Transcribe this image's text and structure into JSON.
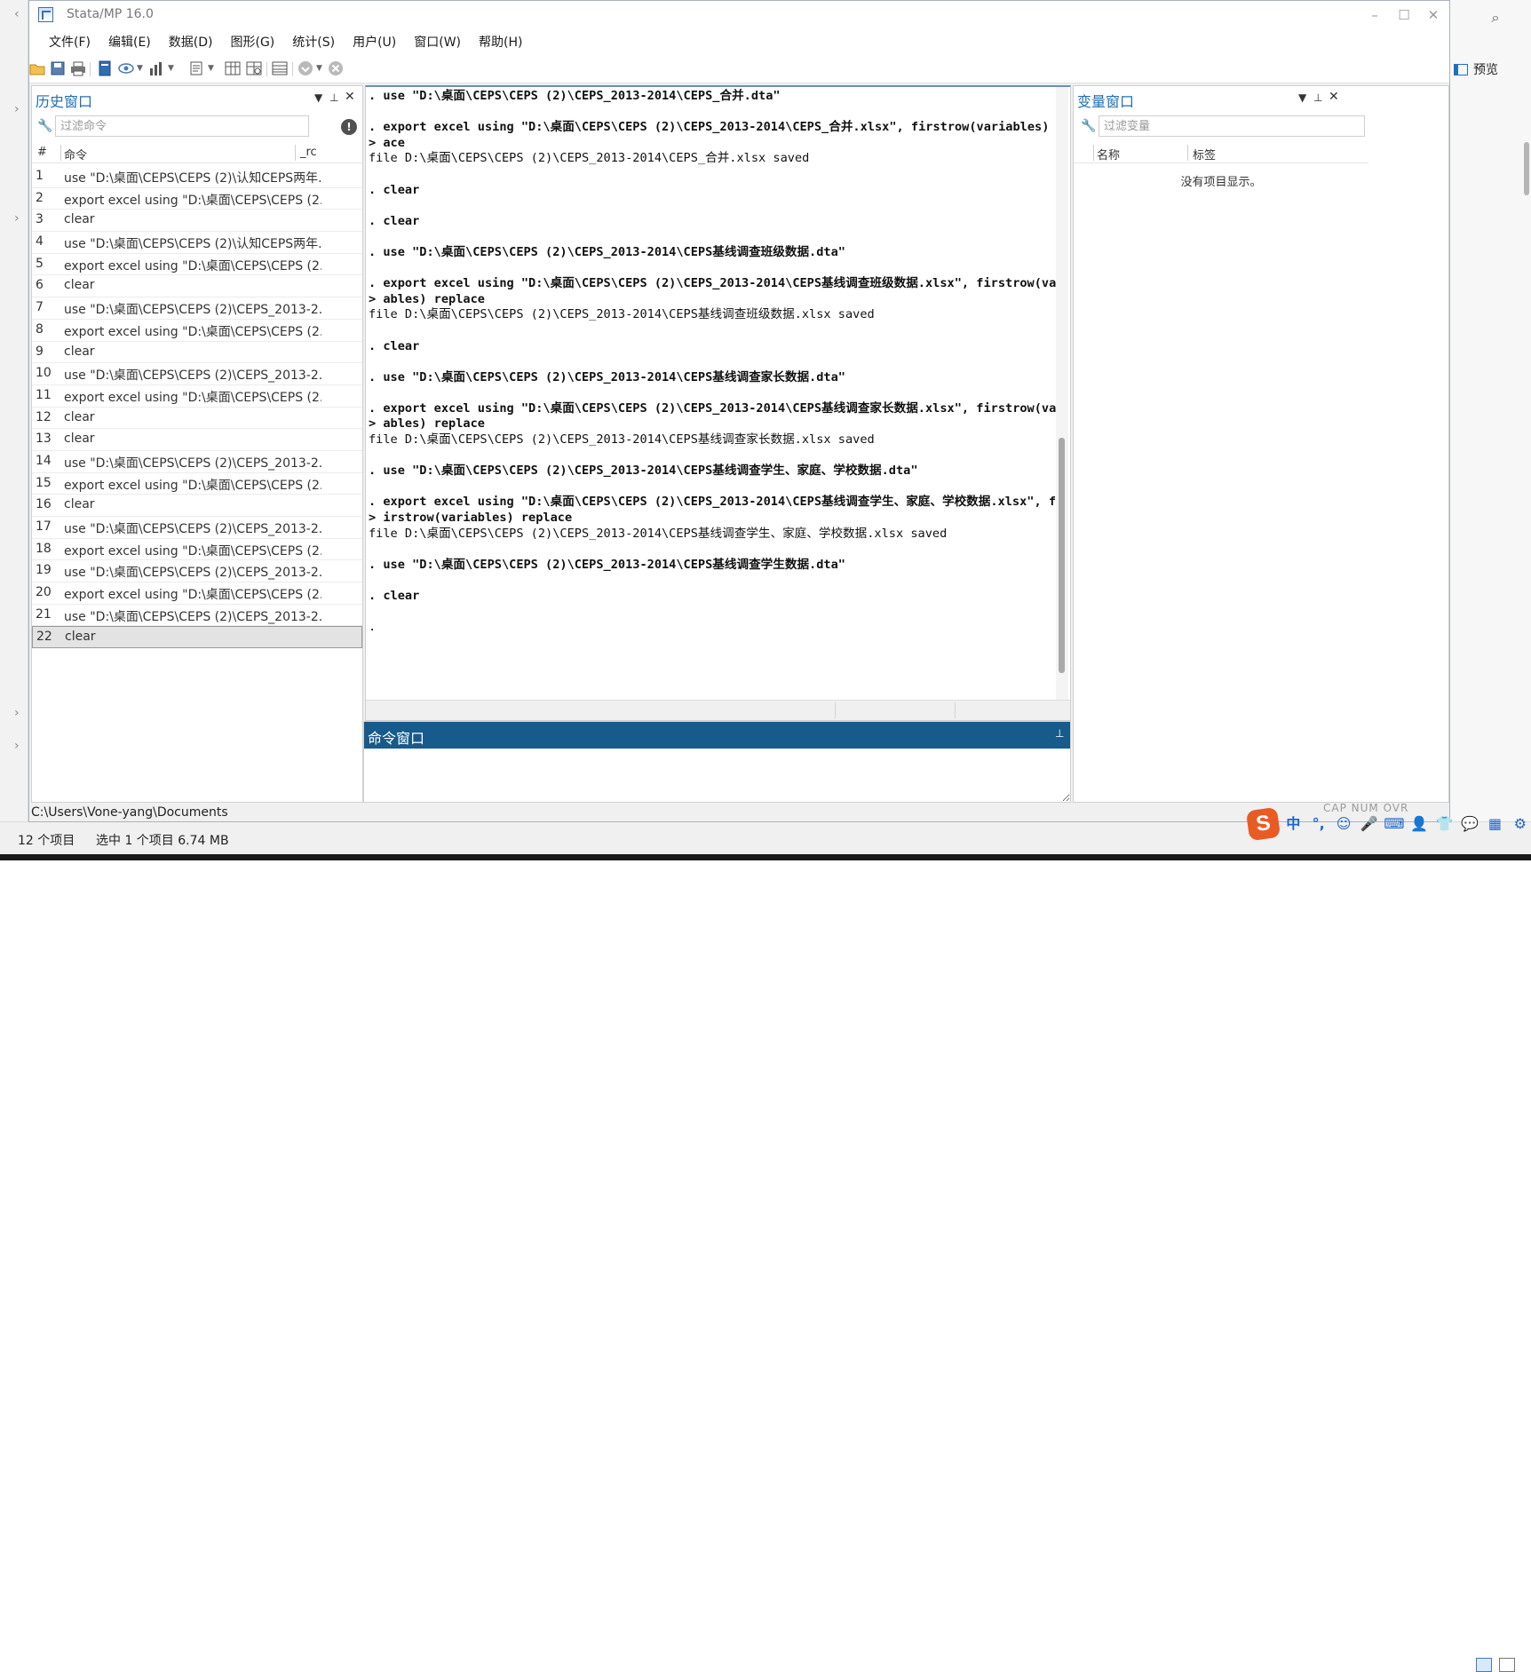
{
  "window": {
    "title": "Stata/MP 16.0",
    "controls": [
      "–",
      "☐",
      "✕"
    ]
  },
  "menu": [
    "文件(F)",
    "编辑(E)",
    "数据(D)",
    "图形(G)",
    "统计(S)",
    "用户(U)",
    "窗口(W)",
    "帮助(H)"
  ],
  "toolbar": {
    "icons": [
      "open-icon",
      "save-icon",
      "print-icon",
      "log-icon",
      "viewer-icon",
      "graph-icon",
      "do-file-editor-icon",
      "data-editor-icon",
      "data-browser-icon",
      "variables-manager-icon",
      "more-icon",
      "break-icon"
    ]
  },
  "history": {
    "title": "历史窗口",
    "filter_placeholder": "过滤命令",
    "columns": [
      "#",
      "命令",
      "_rc"
    ],
    "rows": [
      {
        "num": "1",
        "cmd": "use \"D:\\桌面\\CEPS\\CEPS (2)\\认知CEPS两年..."
      },
      {
        "num": "2",
        "cmd": "export excel using \"D:\\桌面\\CEPS\\CEPS (2..."
      },
      {
        "num": "3",
        "cmd": "clear"
      },
      {
        "num": "4",
        "cmd": "use \"D:\\桌面\\CEPS\\CEPS (2)\\认知CEPS两年..."
      },
      {
        "num": "5",
        "cmd": "export excel using \"D:\\桌面\\CEPS\\CEPS (2..."
      },
      {
        "num": "6",
        "cmd": "clear"
      },
      {
        "num": "7",
        "cmd": "use \"D:\\桌面\\CEPS\\CEPS (2)\\CEPS_2013-2..."
      },
      {
        "num": "8",
        "cmd": "export excel using \"D:\\桌面\\CEPS\\CEPS (2..."
      },
      {
        "num": "9",
        "cmd": "clear"
      },
      {
        "num": "10",
        "cmd": "use \"D:\\桌面\\CEPS\\CEPS (2)\\CEPS_2013-2..."
      },
      {
        "num": "11",
        "cmd": "export excel using \"D:\\桌面\\CEPS\\CEPS (2..."
      },
      {
        "num": "12",
        "cmd": "clear"
      },
      {
        "num": "13",
        "cmd": "clear"
      },
      {
        "num": "14",
        "cmd": "use \"D:\\桌面\\CEPS\\CEPS (2)\\CEPS_2013-2..."
      },
      {
        "num": "15",
        "cmd": "export excel using \"D:\\桌面\\CEPS\\CEPS (2..."
      },
      {
        "num": "16",
        "cmd": "clear"
      },
      {
        "num": "17",
        "cmd": "use \"D:\\桌面\\CEPS\\CEPS (2)\\CEPS_2013-2..."
      },
      {
        "num": "18",
        "cmd": "export excel using \"D:\\桌面\\CEPS\\CEPS (2..."
      },
      {
        "num": "19",
        "cmd": "use \"D:\\桌面\\CEPS\\CEPS (2)\\CEPS_2013-2..."
      },
      {
        "num": "20",
        "cmd": "export excel using \"D:\\桌面\\CEPS\\CEPS (2..."
      },
      {
        "num": "21",
        "cmd": "use \"D:\\桌面\\CEPS\\CEPS (2)\\CEPS_2013-2..."
      },
      {
        "num": "22",
        "cmd": "clear"
      }
    ],
    "selected_row": 22
  },
  "results": {
    "lines": [
      {
        "text": ". use \"D:\\桌面\\CEPS\\CEPS (2)\\CEPS_2013-2014\\CEPS_合并.dta\"",
        "bold": true
      },
      {
        "text": "",
        "bold": false
      },
      {
        "text": ". export excel using \"D:\\桌面\\CEPS\\CEPS (2)\\CEPS_2013-2014\\CEPS_合并.xlsx\", firstrow(variables) repl",
        "bold": true
      },
      {
        "text": "> ace",
        "bold": true
      },
      {
        "text": "file D:\\桌面\\CEPS\\CEPS (2)\\CEPS_2013-2014\\CEPS_合并.xlsx saved",
        "bold": false
      },
      {
        "text": "",
        "bold": false
      },
      {
        "text": ". clear",
        "bold": true
      },
      {
        "text": "",
        "bold": false
      },
      {
        "text": ". clear",
        "bold": true
      },
      {
        "text": "",
        "bold": false
      },
      {
        "text": ". use \"D:\\桌面\\CEPS\\CEPS (2)\\CEPS_2013-2014\\CEPS基线调查班级数据.dta\"",
        "bold": true
      },
      {
        "text": "",
        "bold": false
      },
      {
        "text": ". export excel using \"D:\\桌面\\CEPS\\CEPS (2)\\CEPS_2013-2014\\CEPS基线调查班级数据.xlsx\", firstrow(vari",
        "bold": true
      },
      {
        "text": "> ables) replace",
        "bold": true
      },
      {
        "text": "file D:\\桌面\\CEPS\\CEPS (2)\\CEPS_2013-2014\\CEPS基线调查班级数据.xlsx saved",
        "bold": false
      },
      {
        "text": "",
        "bold": false
      },
      {
        "text": ". clear",
        "bold": true
      },
      {
        "text": "",
        "bold": false
      },
      {
        "text": ". use \"D:\\桌面\\CEPS\\CEPS (2)\\CEPS_2013-2014\\CEPS基线调查家长数据.dta\"",
        "bold": true
      },
      {
        "text": "",
        "bold": false
      },
      {
        "text": ". export excel using \"D:\\桌面\\CEPS\\CEPS (2)\\CEPS_2013-2014\\CEPS基线调查家长数据.xlsx\", firstrow(vari",
        "bold": true
      },
      {
        "text": "> ables) replace",
        "bold": true
      },
      {
        "text": "file D:\\桌面\\CEPS\\CEPS (2)\\CEPS_2013-2014\\CEPS基线调查家长数据.xlsx saved",
        "bold": false
      },
      {
        "text": "",
        "bold": false
      },
      {
        "text": ". use \"D:\\桌面\\CEPS\\CEPS (2)\\CEPS_2013-2014\\CEPS基线调查学生、家庭、学校数据.dta\"",
        "bold": true
      },
      {
        "text": "",
        "bold": false
      },
      {
        "text": ". export excel using \"D:\\桌面\\CEPS\\CEPS (2)\\CEPS_2013-2014\\CEPS基线调查学生、家庭、学校数据.xlsx\", f",
        "bold": true
      },
      {
        "text": "> irstrow(variables) replace",
        "bold": true
      },
      {
        "text": "file D:\\桌面\\CEPS\\CEPS (2)\\CEPS_2013-2014\\CEPS基线调查学生、家庭、学校数据.xlsx saved",
        "bold": false
      },
      {
        "text": "",
        "bold": false
      },
      {
        "text": ". use \"D:\\桌面\\CEPS\\CEPS (2)\\CEPS_2013-2014\\CEPS基线调查学生数据.dta\"",
        "bold": true
      },
      {
        "text": "",
        "bold": false
      },
      {
        "text": ". clear",
        "bold": true
      },
      {
        "text": "",
        "bold": false
      },
      {
        "text": ".",
        "bold": false
      }
    ]
  },
  "command": {
    "title": "命令窗口",
    "value": ""
  },
  "variables": {
    "title": "变量窗口",
    "filter_placeholder": "过滤变量",
    "columns": [
      "名称",
      "标签"
    ],
    "empty_message": "没有项目显示。"
  },
  "stata_status": {
    "path": "C:\\Users\\Vone-yang\\Documents",
    "indicators": "CAP  NUM  OVR"
  },
  "explorer": {
    "items_count": "12 个项目",
    "selected_info": "选中 1 个项目  6.74 MB",
    "preview_label": "预览"
  },
  "ime": {
    "items": [
      "中",
      "°,",
      "☺",
      "🎤",
      "⌨",
      "👤",
      "👕",
      "💬",
      "▦",
      "⚙"
    ]
  },
  "colors": {
    "pane_title": "#1f6fb2",
    "command_bar": "#175a8c",
    "ime_logo": "#ea5b24"
  }
}
